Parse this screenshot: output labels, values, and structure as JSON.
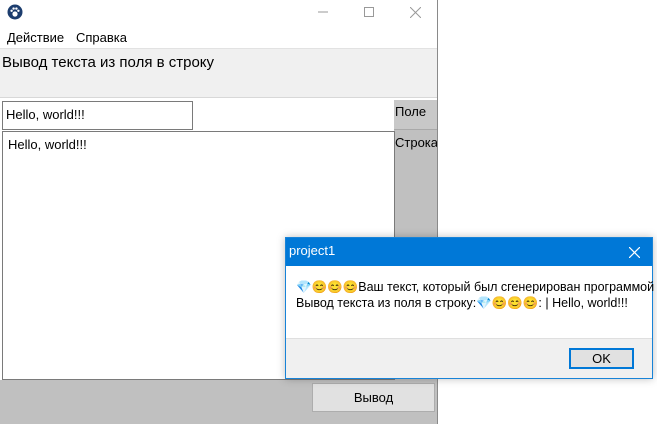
{
  "window": {
    "title": "",
    "minimize_icon": "minimize-icon",
    "maximize_icon": "maximize-icon",
    "close_icon": "close-icon"
  },
  "menu": {
    "items": [
      {
        "label": "Действие"
      },
      {
        "label": "Справка"
      }
    ]
  },
  "header": {
    "label": "Вывод текста из поля в строку"
  },
  "input": {
    "value": "Hello, world!!!"
  },
  "side_buttons": {
    "field_label": "Поле",
    "string_label": "Строка"
  },
  "memo": {
    "text": "Hello, world!!!"
  },
  "bottom": {
    "output_label": "Вывод"
  },
  "dialog": {
    "title": "project1",
    "line1": "💎😊😊😊Ваш текст, который был сгенерирован программой",
    "line2": "Вывод текста из поля в строку:💎😊😊😊:  |  Hello, world!!!",
    "ok_label": "OK",
    "accent": "#0078d7"
  }
}
